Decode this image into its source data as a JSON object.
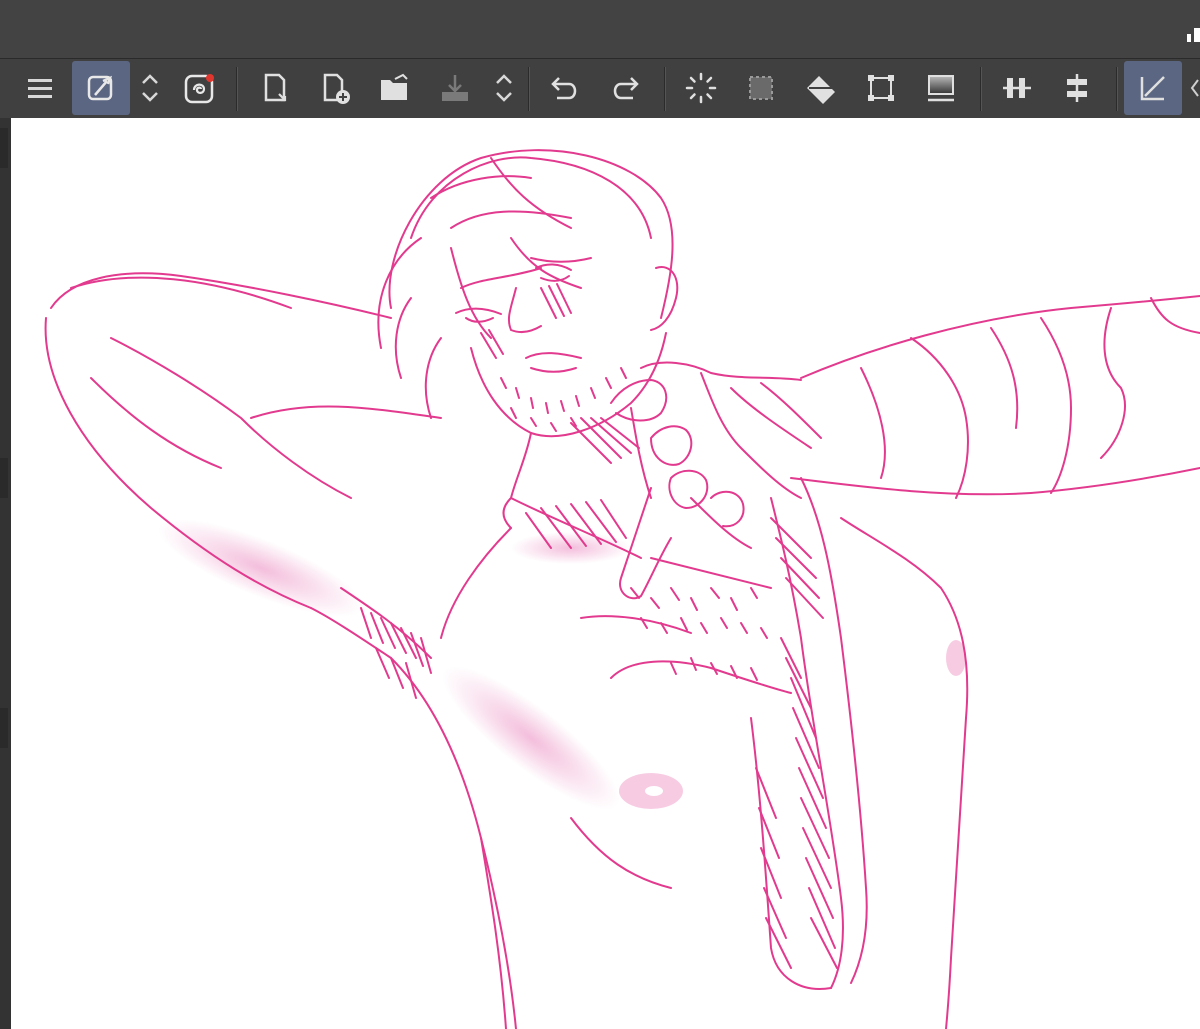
{
  "app": {
    "window": "drawing-application"
  },
  "toolbar": {
    "buttons": [
      {
        "id": "menu",
        "icon": "menu-icon"
      },
      {
        "id": "pen-tool",
        "icon": "pen-eyedropper-icon",
        "active": true
      },
      {
        "id": "tool-switch",
        "icon": "up-down-chevron-icon"
      },
      {
        "id": "cloud",
        "icon": "clip-studio-cloud-icon"
      },
      {
        "id": "new-from-clipboard",
        "icon": "new-page-icon"
      },
      {
        "id": "new-canvas",
        "icon": "new-canvas-icon"
      },
      {
        "id": "open-file",
        "icon": "folder-open-icon"
      },
      {
        "id": "save",
        "icon": "save-icon"
      },
      {
        "id": "save-switch",
        "icon": "up-down-chevron-icon"
      },
      {
        "id": "undo",
        "icon": "undo-icon"
      },
      {
        "id": "redo",
        "icon": "redo-icon"
      },
      {
        "id": "loading",
        "icon": "spinner-icon"
      },
      {
        "id": "selection",
        "icon": "selection-icon"
      },
      {
        "id": "fill",
        "icon": "fill-bucket-icon"
      },
      {
        "id": "transform",
        "icon": "transform-icon"
      },
      {
        "id": "screen-tone",
        "icon": "screentone-icon"
      },
      {
        "id": "align-horizontal",
        "icon": "align-horizontal-icon"
      },
      {
        "id": "align-vertical",
        "icon": "align-vertical-icon"
      },
      {
        "id": "ruler-snap",
        "icon": "ruler-snap-icon",
        "active": true
      }
    ]
  },
  "canvas": {
    "stroke_color": "#e23a8e",
    "shadow_color": "#f0a8d0",
    "background": "#ffffff"
  }
}
